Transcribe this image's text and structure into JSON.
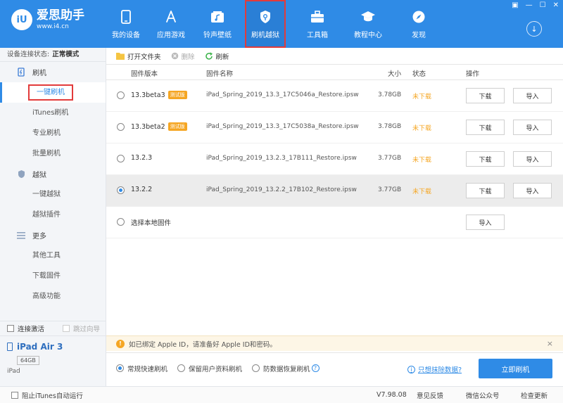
{
  "app": {
    "name": "爱思助手",
    "url": "www.i4.cn",
    "logo_text": "iU"
  },
  "nav": [
    {
      "label": "我的设备",
      "icon": "phone-icon"
    },
    {
      "label": "应用游戏",
      "icon": "app-store-icon"
    },
    {
      "label": "铃声壁纸",
      "icon": "music-wallpaper-icon"
    },
    {
      "label": "刷机越狱",
      "icon": "shield-key-icon"
    },
    {
      "label": "工具箱",
      "icon": "toolbox-icon"
    },
    {
      "label": "教程中心",
      "icon": "graduation-cap-icon"
    },
    {
      "label": "发现",
      "icon": "compass-icon"
    }
  ],
  "sidebar": {
    "status_label": "设备连接状态:",
    "status_value": "正常模式",
    "groups": [
      {
        "label": "刷机",
        "items": [
          "一键刷机",
          "iTunes刷机",
          "专业刷机",
          "批量刷机"
        ]
      },
      {
        "label": "越狱",
        "items": [
          "一键越狱",
          "越狱插件"
        ]
      },
      {
        "label": "更多",
        "items": [
          "其他工具",
          "下载固件",
          "高级功能"
        ]
      }
    ],
    "check_activate": "连接激活",
    "check_skip": "跳过向导",
    "device_name": "iPad Air 3",
    "device_capacity": "64GB",
    "device_type": "iPad"
  },
  "toolbar": {
    "open_folder": "打开文件夹",
    "delete": "删除",
    "refresh": "刷新"
  },
  "columns": {
    "version": "固件版本",
    "name": "固件名称",
    "size": "大小",
    "status": "状态",
    "action": "操作"
  },
  "firmware": [
    {
      "version": "13.3beta3",
      "badge": "测试版",
      "name": "iPad_Spring_2019_13.3_17C5046a_Restore.ipsw",
      "size": "3.78GB",
      "status": "未下载",
      "download": "下载",
      "import": "导入"
    },
    {
      "version": "13.3beta2",
      "badge": "测试版",
      "name": "iPad_Spring_2019_13.3_17C5038a_Restore.ipsw",
      "size": "3.78GB",
      "status": "未下载",
      "download": "下载",
      "import": "导入"
    },
    {
      "version": "13.2.3",
      "badge": "",
      "name": "iPad_Spring_2019_13.2.3_17B111_Restore.ipsw",
      "size": "3.77GB",
      "status": "未下载",
      "download": "下载",
      "import": "导入"
    },
    {
      "version": "13.2.2",
      "badge": "",
      "name": "iPad_Spring_2019_13.2.2_17B102_Restore.ipsw",
      "size": "3.77GB",
      "status": "未下载",
      "download": "下载",
      "import": "导入"
    }
  ],
  "local_firmware": {
    "label": "选择本地固件",
    "import": "导入"
  },
  "notice": {
    "text": "如已绑定 Apple ID，请准备好 Apple ID和密码。",
    "close": "×"
  },
  "flash_options": [
    "常规快速刷机",
    "保留用户资料刷机",
    "防数据恢复刷机"
  ],
  "erase_link": "只想抹除数据?",
  "flash_button": "立即刷机",
  "footer": {
    "block_itunes": "阻止iTunes自动运行",
    "version": "V7.98.08",
    "feedback": "意见反馈",
    "wechat": "微信公众号",
    "update": "检查更新"
  },
  "colors": {
    "primary": "#2f8be6",
    "warning": "#f5a623",
    "highlight": "#e23b3b"
  }
}
